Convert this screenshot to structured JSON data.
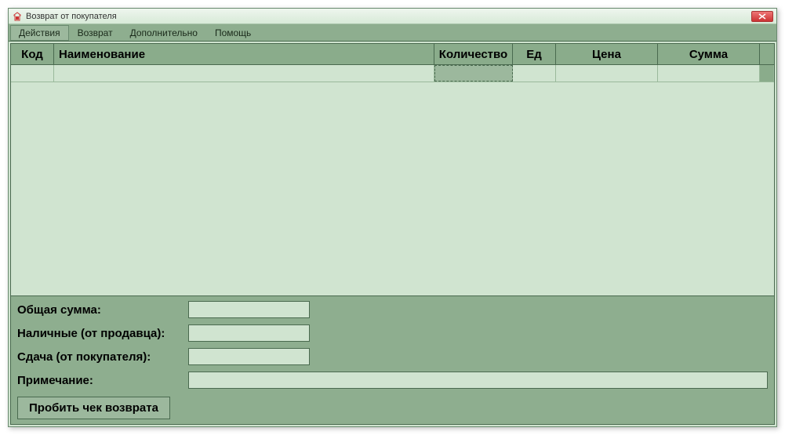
{
  "window": {
    "title": "Возврат от покупателя"
  },
  "menu": {
    "actions": "Действия",
    "return": "Возврат",
    "extra": "Дополнительно",
    "help": "Помощь"
  },
  "grid": {
    "headers": {
      "code": "Код",
      "name": "Наименование",
      "qty": "Количество",
      "unit": "Ед",
      "price": "Цена",
      "sum": "Сумма"
    },
    "rows": [
      {
        "code": "",
        "name": "",
        "qty": "",
        "unit": "",
        "price": "",
        "sum": ""
      }
    ]
  },
  "totals": {
    "total_label": "Общая сумма:",
    "total_value": "",
    "cash_label": "Наличные (от продавца):",
    "cash_value": "",
    "change_label": "Сдача (от покупателя):",
    "change_value": "",
    "note_label": "Примечание:",
    "note_value": ""
  },
  "action_button": "Пробить чек возврата"
}
